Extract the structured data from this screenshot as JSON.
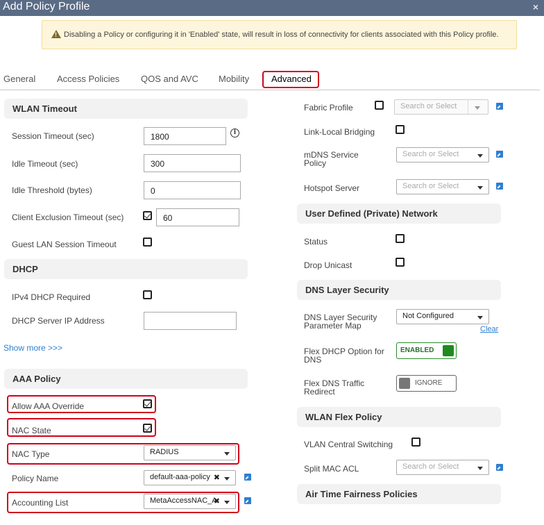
{
  "window": {
    "title": "Add Policy Profile",
    "close_glyph": "×"
  },
  "warning": {
    "text": "Disabling a Policy or configuring it in 'Enabled' state, will result in loss of connectivity for clients associated with this Policy profile."
  },
  "tabs": [
    {
      "label": "General"
    },
    {
      "label": "Access Policies"
    },
    {
      "label": "QOS and AVC"
    },
    {
      "label": "Mobility"
    },
    {
      "label": "Advanced",
      "active": true
    }
  ],
  "wlan_timeout": {
    "header": "WLAN Timeout",
    "session_timeout": {
      "label": "Session Timeout (sec)",
      "value": "1800"
    },
    "idle_timeout": {
      "label": "Idle Timeout (sec)",
      "value": "300"
    },
    "idle_threshold": {
      "label": "Idle Threshold (bytes)",
      "value": "0"
    },
    "client_exclusion": {
      "label": "Client Exclusion Timeout (sec)",
      "checked": true,
      "value": "60"
    },
    "guest_lan": {
      "label": "Guest LAN Session Timeout",
      "checked": false
    }
  },
  "dhcp": {
    "header": "DHCP",
    "ipv4_required": {
      "label": "IPv4 DHCP Required",
      "checked": false
    },
    "server_ip": {
      "label": "DHCP Server IP Address",
      "value": ""
    },
    "show_more": "Show more >>>"
  },
  "aaa_policy": {
    "header": "AAA Policy",
    "allow_override": {
      "label": "Allow AAA Override",
      "checked": true
    },
    "nac_state": {
      "label": "NAC State",
      "checked": true
    },
    "nac_type": {
      "label": "NAC Type",
      "value": "RADIUS"
    },
    "policy_name": {
      "label": "Policy Name",
      "value": "default-aaa-policy"
    },
    "accounting_list": {
      "label": "Accounting List",
      "value": "MetaAccessNAC_A"
    }
  },
  "right": {
    "fabric_profile": {
      "label": "Fabric Profile",
      "checked": false,
      "placeholder": "Search or Select"
    },
    "link_local": {
      "label": "Link-Local Bridging",
      "checked": false
    },
    "mdns": {
      "label": "mDNS Service Policy",
      "placeholder": "Search or Select"
    },
    "hotspot": {
      "label": "Hotspot Server",
      "placeholder": "Search or Select"
    },
    "udn_header": "User Defined (Private) Network",
    "status": {
      "label": "Status",
      "checked": false
    },
    "drop_unicast": {
      "label": "Drop Unicast",
      "checked": false
    },
    "dns_header": "DNS Layer Security",
    "dns_param": {
      "label": "DNS Layer Security Parameter Map",
      "value": "Not Configured",
      "clear": "Clear"
    },
    "flex_dhcp": {
      "label": "Flex DHCP Option for DNS",
      "state": "ENABLED"
    },
    "flex_dns": {
      "label": "Flex DNS Traffic Redirect",
      "state": "IGNORE"
    },
    "wlan_flex_header": "WLAN Flex Policy",
    "vlan_central": {
      "label": "VLAN Central Switching",
      "checked": false
    },
    "split_mac": {
      "label": "Split MAC ACL",
      "placeholder": "Search or Select"
    },
    "atf_header": "Air Time Fairness Policies"
  },
  "colors": {
    "title_bar": "#5a6b85",
    "highlight": "#d0021b",
    "link": "#2f7fd1",
    "enabled": "#1f8a1f"
  }
}
